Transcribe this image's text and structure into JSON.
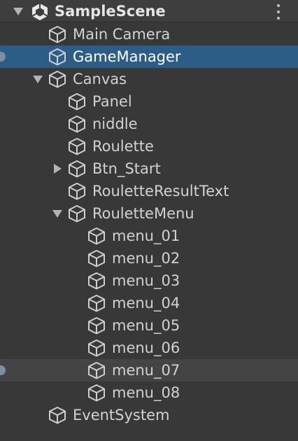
{
  "hierarchy": {
    "scene": {
      "name": "SampleScene",
      "icon": "unity-scene-icon",
      "foldout": "expanded",
      "menu_icon": "kebab-menu-icon"
    },
    "items": [
      {
        "label": "Main Camera",
        "icon": "gameobject-cube-icon"
      },
      {
        "label": "GameManager",
        "icon": "gameobject-cube-icon",
        "selected": true
      },
      {
        "label": "Canvas",
        "icon": "gameobject-cube-icon",
        "foldout": "expanded"
      },
      {
        "label": "Panel",
        "icon": "gameobject-cube-icon"
      },
      {
        "label": "niddle",
        "icon": "gameobject-cube-icon"
      },
      {
        "label": "Roulette",
        "icon": "gameobject-cube-icon"
      },
      {
        "label": "Btn_Start",
        "icon": "gameobject-cube-icon",
        "foldout": "collapsed"
      },
      {
        "label": "RouletteResultText",
        "icon": "gameobject-cube-icon"
      },
      {
        "label": "RouletteMenu",
        "icon": "gameobject-cube-icon",
        "foldout": "expanded"
      },
      {
        "label": "menu_01",
        "icon": "gameobject-cube-icon"
      },
      {
        "label": "menu_02",
        "icon": "gameobject-cube-icon"
      },
      {
        "label": "menu_03",
        "icon": "gameobject-cube-icon"
      },
      {
        "label": "menu_04",
        "icon": "gameobject-cube-icon"
      },
      {
        "label": "menu_05",
        "icon": "gameobject-cube-icon"
      },
      {
        "label": "menu_06",
        "icon": "gameobject-cube-icon"
      },
      {
        "label": "menu_07",
        "icon": "gameobject-cube-icon",
        "hovered": true
      },
      {
        "label": "menu_08",
        "icon": "gameobject-cube-icon"
      },
      {
        "label": "EventSystem",
        "icon": "gameobject-cube-icon"
      }
    ]
  },
  "colors": {
    "background": "#383838",
    "selected_row": "#2c5d87",
    "hover_row": "#444444",
    "text": "#d2d2d2"
  }
}
